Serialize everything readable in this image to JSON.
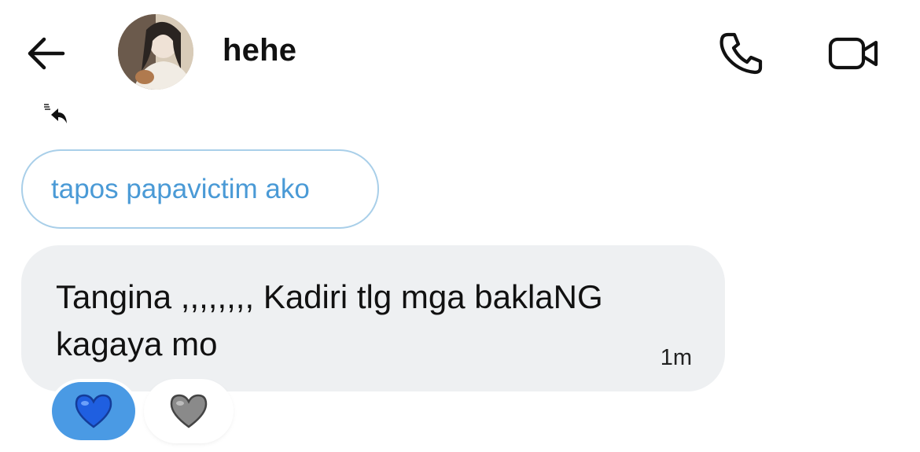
{
  "header": {
    "title": "hehe",
    "back_icon": "arrow-left-icon",
    "call_icon": "phone-icon",
    "video_icon": "video-camera-icon"
  },
  "reply_indicator": {
    "icon": "reply-arrow-icon"
  },
  "quoted_message": {
    "text": "tapos papavictim ako"
  },
  "message": {
    "text": "Tangina ,,,,,,,, Kadiri tlg mga baklaNG kagaya mo",
    "time": "1m"
  },
  "reactions": [
    {
      "name": "blue-heart",
      "emoji": "💙",
      "selected": true,
      "color": "#4a9ae4"
    },
    {
      "name": "grey-heart",
      "emoji": "🩶",
      "selected": false,
      "color": "#8a8a8a"
    }
  ],
  "colors": {
    "quote_border": "#a9cfe9",
    "quote_text": "#4a9ad6",
    "bubble_bg": "#eef0f2"
  }
}
